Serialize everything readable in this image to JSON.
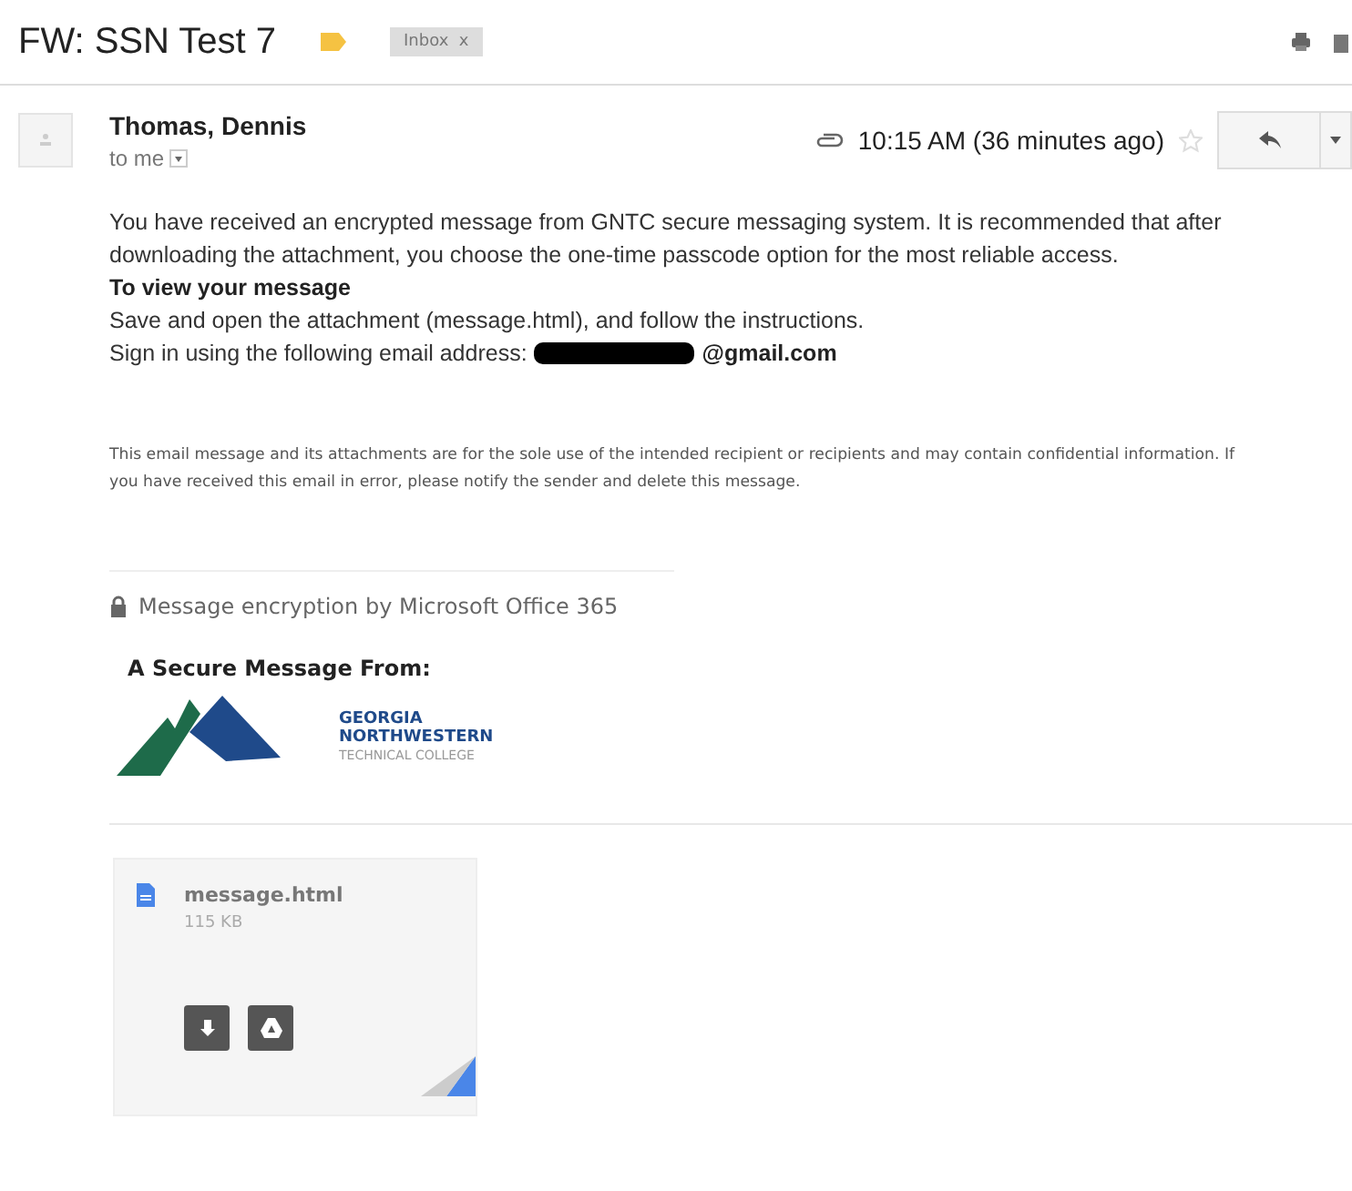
{
  "subject": "FW: SSN Test 7",
  "important": true,
  "labels": [
    {
      "text": "Inbox",
      "close": "x"
    }
  ],
  "sender": {
    "name": "Thomas, Dennis",
    "to": "to me",
    "time": "10:15 AM (36 minutes ago)",
    "starred": false,
    "has_attachment": true
  },
  "body": {
    "paragraph": "You have received an encrypted message from GNTC secure messaging system. It is recommended that after downloading the attachment, you choose the one-time passcode option for the most reliable access.",
    "heading": "To view your message",
    "instruction": "Save and open the attachment (message.html), and follow the instructions.",
    "sign_in_label": "Sign in using the following email address:",
    "email_visible": "@gmail.com",
    "email_redacted": true,
    "disclaimer": "This email message and its attachments are for the sole use of the intended recipient or recipients and may contain confidential information. If you have received this email in error, please notify the sender and delete this message.",
    "encryption": "Message encryption by Microsoft Office 365",
    "secure_from": "A Secure Message From:",
    "logo_lines": [
      "GEORGIA",
      "NORTHWESTERN",
      "TECHNICAL COLLEGE"
    ]
  },
  "attachment": {
    "name": "message.html",
    "size": "115 KB"
  }
}
